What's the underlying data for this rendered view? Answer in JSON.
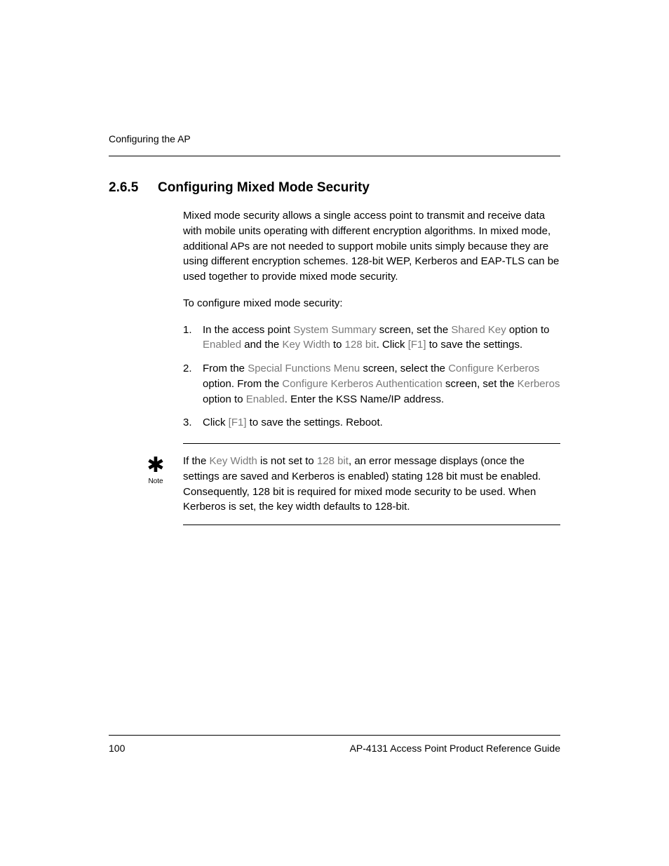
{
  "header": {
    "running": "Configuring the AP"
  },
  "section": {
    "number": "2.6.5",
    "title": "Configuring Mixed Mode Security"
  },
  "content": {
    "intro": "Mixed mode security allows a single access point to transmit and receive data with mobile units operating with different encryption algorithms. In mixed mode, additional APs are not needed to support mobile units simply because they are using different encryption schemes. 128-bit WEP, Kerberos and EAP-TLS can be used together to provide mixed mode security.",
    "lead": "To configure mixed mode security:",
    "step1_a": "In the access point ",
    "step1_b": "System Summary",
    "step1_c": " screen, set the ",
    "step1_d": "Shared Key",
    "step1_e": " option to ",
    "step1_f": "Enabled",
    "step1_g": " and the ",
    "step1_h": "Key Width",
    "step1_i": " to ",
    "step1_j": "128 bit",
    "step1_k": ". Click ",
    "step1_l": "[F1]",
    "step1_m": " to save the settings.",
    "step2_a": "From the ",
    "step2_b": "Special Functions Menu",
    "step2_c": " screen, select the ",
    "step2_d": "Configure Kerberos",
    "step2_e": " option. From the ",
    "step2_f": "Configure Kerberos Authentication",
    "step2_g": " screen, set the ",
    "step2_h": "Kerberos",
    "step2_i": " option to ",
    "step2_j": "Enabled",
    "step2_k": ". Enter the KSS Name/IP address.",
    "step3_a": "Click ",
    "step3_b": "[F1]",
    "step3_c": " to save the settings. Reboot.",
    "note_label": "Note",
    "note_a": "If the ",
    "note_b": "Key Width",
    "note_c": " is not set to ",
    "note_d": "128 bit",
    "note_e": ", an error message displays (once the settings are saved and Kerberos is enabled) stating 128 bit must be enabled. Consequently, 128 bit is required for mixed mode security to be used. When Kerberos is set, the key width defaults to 128-bit."
  },
  "footer": {
    "page": "100",
    "doc": "AP-4131 Access Point Product Reference Guide"
  }
}
